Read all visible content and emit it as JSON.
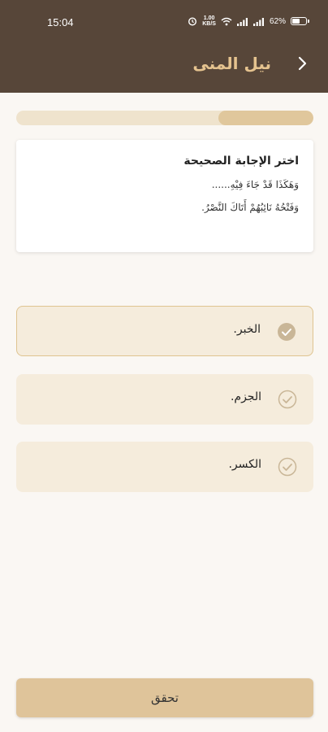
{
  "status_bar": {
    "time": "15:04",
    "net_speed_top": "1.00",
    "net_speed_bottom": "KB/S",
    "battery_text": "62%",
    "battery_level": 0.62
  },
  "app_bar": {
    "title": "نيل المنى",
    "back_icon": "chevron-right-icon"
  },
  "progress": {
    "value": 0.32
  },
  "question": {
    "title": "اختر الإجابة الصحيحة",
    "line1": "وَهَكَذَا قَدْ جَاءَ فِيْهِ......",
    "line2": "وَفَتْحُهُ نَائِبُهُمْ أَتَاكَ النَّصْرُ."
  },
  "options": [
    {
      "label": "الخبر.",
      "selected": true
    },
    {
      "label": "الجزم.",
      "selected": false
    },
    {
      "label": "الكسر.",
      "selected": false
    }
  ],
  "actions": {
    "verify_label": "تحقق"
  },
  "colors": {
    "header_bg": "#574639",
    "title_color": "#e5c38f",
    "option_bg": "#f5ecdc",
    "button_bg": "#dfc49a",
    "page_bg": "#faf7f3"
  }
}
